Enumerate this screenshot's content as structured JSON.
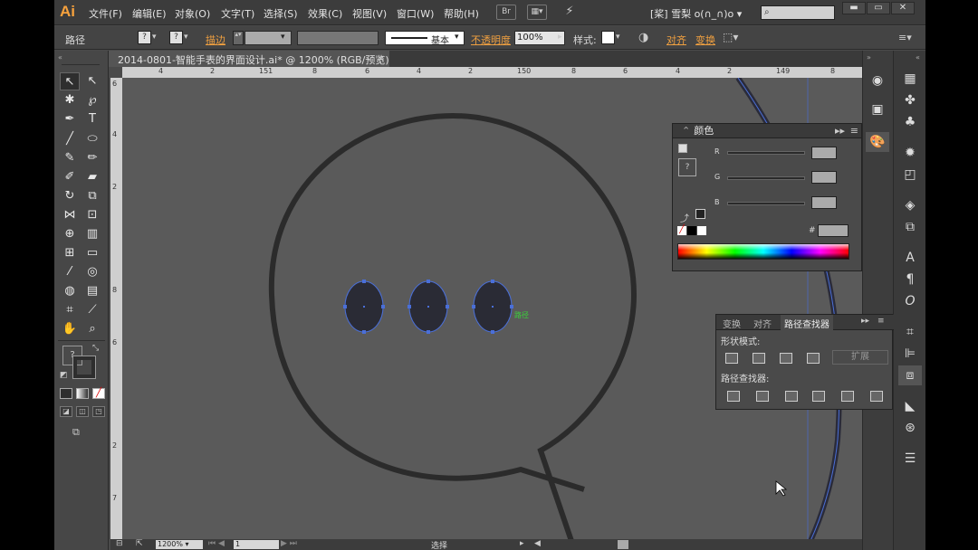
{
  "app": {
    "logo": "Ai",
    "menus": [
      "文件(F)",
      "编辑(E)",
      "对象(O)",
      "文字(T)",
      "选择(S)",
      "效果(C)",
      "视图(V)",
      "窗口(W)",
      "帮助(H)"
    ],
    "br_label": "Br",
    "workspace": "[桨] 雪梨 o(∩_∩)o",
    "window_buttons": [
      "▬",
      "▭",
      "✕"
    ]
  },
  "control_bar": {
    "selection_type": "路径",
    "stroke_label": "描边",
    "stroke_style": "基本",
    "opacity_label": "不透明度",
    "opacity_value": "100%",
    "style_label": "样式",
    "align_label": "对齐",
    "transform_label": "变换"
  },
  "document": {
    "tab_title": "2014-0801-智能手表的界面设计.ai* @ 1200% (RGB/预览)",
    "close": "×",
    "ruler_top": [
      "4",
      "2",
      "151",
      "8",
      "6",
      "4",
      "2",
      "150",
      "8",
      "6",
      "4",
      "2",
      "149",
      "8"
    ],
    "ruler_left": [
      "6",
      "4",
      "2",
      "8",
      "6",
      "2",
      "7"
    ],
    "path_hover_label": "路径"
  },
  "status_bar": {
    "zoom": "1200%",
    "artboard": "1",
    "tool": "选择"
  },
  "color_panel": {
    "title": "颜色",
    "channels": [
      "R",
      "G",
      "B"
    ],
    "hex_label": "#"
  },
  "pathfinder_panel": {
    "tabs": [
      "变换",
      "对齐",
      "路径查找器"
    ],
    "shape_modes_label": "形状模式:",
    "expand_label": "扩展",
    "pathfinders_label": "路径查找器:"
  },
  "colors": {
    "accent": "#f7a23d",
    "selection": "#4a6fd8",
    "canvas": "#5a5a5a",
    "shape_stroke": "#2b2b2b",
    "dot_fill": "#2a2b35"
  }
}
